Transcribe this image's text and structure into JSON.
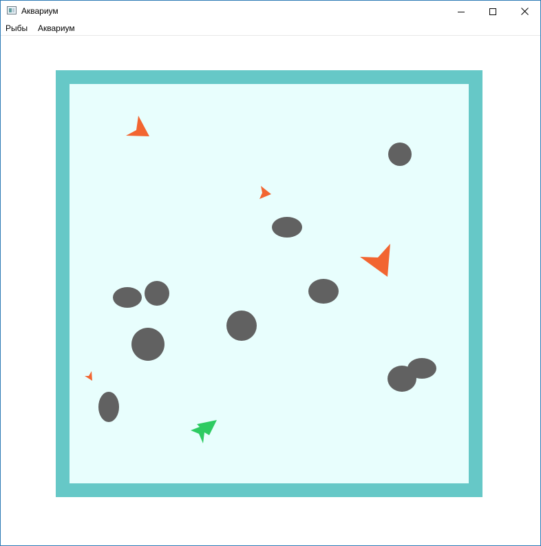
{
  "window": {
    "title": "Аквариум",
    "controls": {
      "minimize": "minimize-icon",
      "maximize": "maximize-icon",
      "close": "close-icon"
    }
  },
  "menu": {
    "items": [
      "Рыбы",
      "Аквариум"
    ]
  },
  "aquarium": {
    "colors": {
      "frame": "#66c8c7",
      "water": "#e8fefd",
      "stone": "#616161",
      "fish_predator": "#f26531",
      "fish_player": "#2ecb62"
    },
    "stone_count": 11,
    "fish_count": 6
  }
}
